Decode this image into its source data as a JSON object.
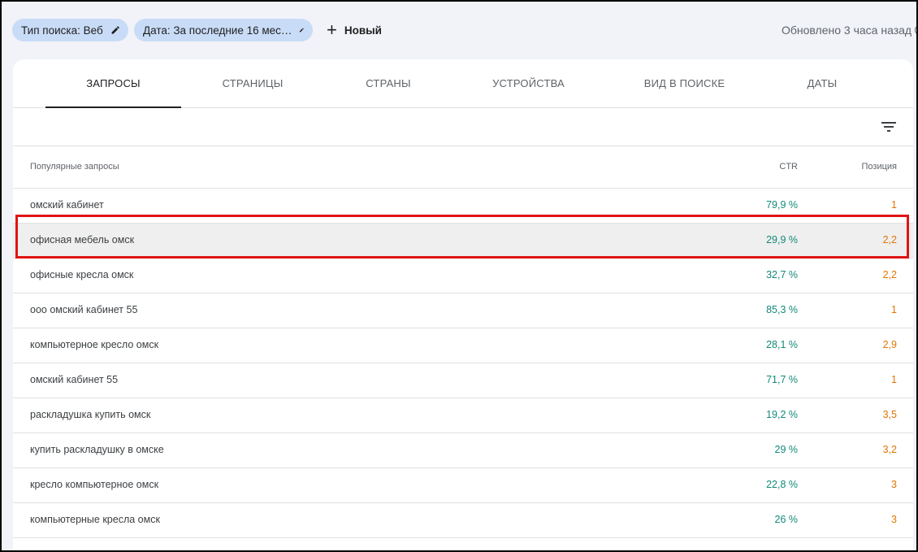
{
  "filters": {
    "search_type": "Тип поиска: Веб",
    "date": "Дата: За последние 16 мес…",
    "new_button": "Новый"
  },
  "updated_text": "Обновлено 3 часа назад",
  "tabs": [
    {
      "label": "ЗАПРОСЫ",
      "active": true
    },
    {
      "label": "СТРАНИЦЫ",
      "active": false
    },
    {
      "label": "СТРАНЫ",
      "active": false
    },
    {
      "label": "УСТРОЙСТВА",
      "active": false
    },
    {
      "label": "ВИД В ПОИСКЕ",
      "active": false
    },
    {
      "label": "ДАТЫ",
      "active": false
    }
  ],
  "table": {
    "headers": {
      "query": "Популярные запросы",
      "ctr": "CTR",
      "position": "Позиция"
    },
    "rows": [
      {
        "query": "омский кабинет",
        "ctr": "79,9 %",
        "position": "1"
      },
      {
        "query": "офисная мебель омск",
        "ctr": "29,9 %",
        "position": "2,2",
        "highlighted": true
      },
      {
        "query": "офисные кресла омск",
        "ctr": "32,7 %",
        "position": "2,2"
      },
      {
        "query": "ооо омский кабинет 55",
        "ctr": "85,3 %",
        "position": "1"
      },
      {
        "query": "компьютерное кресло омск",
        "ctr": "28,1 %",
        "position": "2,9"
      },
      {
        "query": "омский кабинет 55",
        "ctr": "71,7 %",
        "position": "1"
      },
      {
        "query": "раскладушка купить омск",
        "ctr": "19,2 %",
        "position": "3,5"
      },
      {
        "query": "купить раскладушку в омске",
        "ctr": "29 %",
        "position": "3,2"
      },
      {
        "query": "кресло компьютерное омск",
        "ctr": "22,8 %",
        "position": "3"
      },
      {
        "query": "компьютерные кресла омск",
        "ctr": "26 %",
        "position": "3"
      }
    ]
  },
  "colors": {
    "ctr": "#12897a",
    "position": "#e37400",
    "highlight_border": "#e01414",
    "chip": "#c9dcf7"
  },
  "icons": {
    "edit": "pencil-icon",
    "add": "plus-icon",
    "filter": "filter-list-icon",
    "time": "clock-icon"
  }
}
